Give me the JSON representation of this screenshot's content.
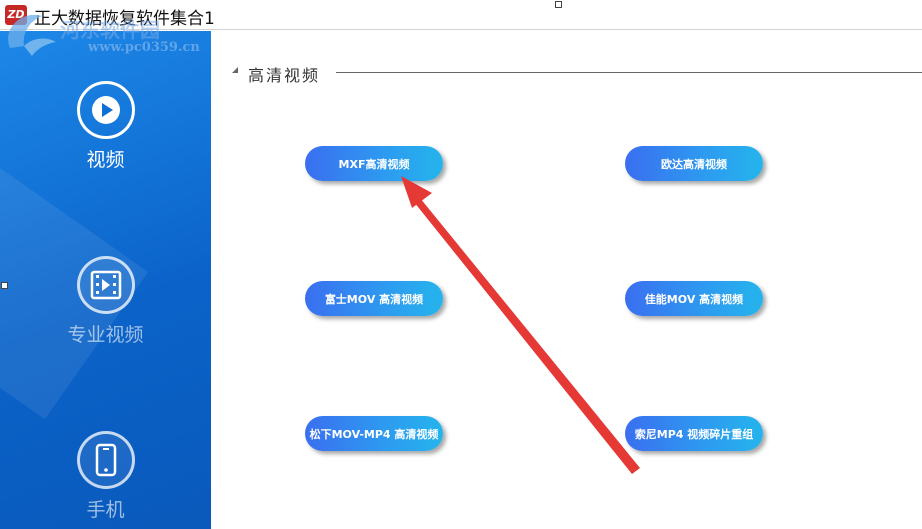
{
  "window": {
    "icon_text": "ZD",
    "title": "正大数据恢复软件集合1"
  },
  "watermark": {
    "text": "河东软件园",
    "url": "www.pc0359.cn"
  },
  "sidebar": {
    "items": [
      {
        "label": "视频",
        "icon": "play-icon",
        "selected": true
      },
      {
        "label": "专业视频",
        "icon": "film-icon",
        "selected": false
      },
      {
        "label": "手机",
        "icon": "phone-icon",
        "selected": false
      }
    ]
  },
  "main": {
    "section_title": "高清视频",
    "buttons": [
      {
        "label": "MXF高清视频"
      },
      {
        "label": "欧达高清视频"
      },
      {
        "label": "富士MOV 高清视频"
      },
      {
        "label": "佳能MOV 高清视频"
      },
      {
        "label": "松下MOV-MP4 高清视频"
      },
      {
        "label": "索尼MP4 视频碎片重组"
      }
    ]
  },
  "colors": {
    "sidebar_blue": "#0b63c9",
    "button_start": "#3a6ff0",
    "button_end": "#24b4ec",
    "annotation_arrow": "#e53935"
  }
}
